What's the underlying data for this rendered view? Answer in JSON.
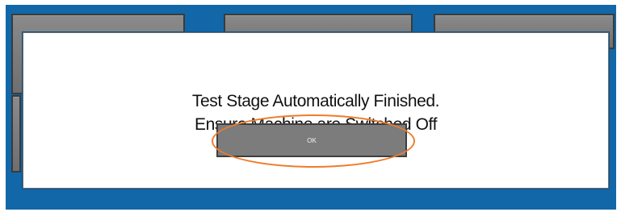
{
  "dialog": {
    "message_line1": "Test Stage Automatically Finished.",
    "message_line2": "Ensure Machine are Switched Off",
    "ok_label": "OK"
  },
  "colors": {
    "background_blue": "#1267a8",
    "button_gray": "#7c7c7c",
    "annotation_orange": "#ef7c2a"
  }
}
